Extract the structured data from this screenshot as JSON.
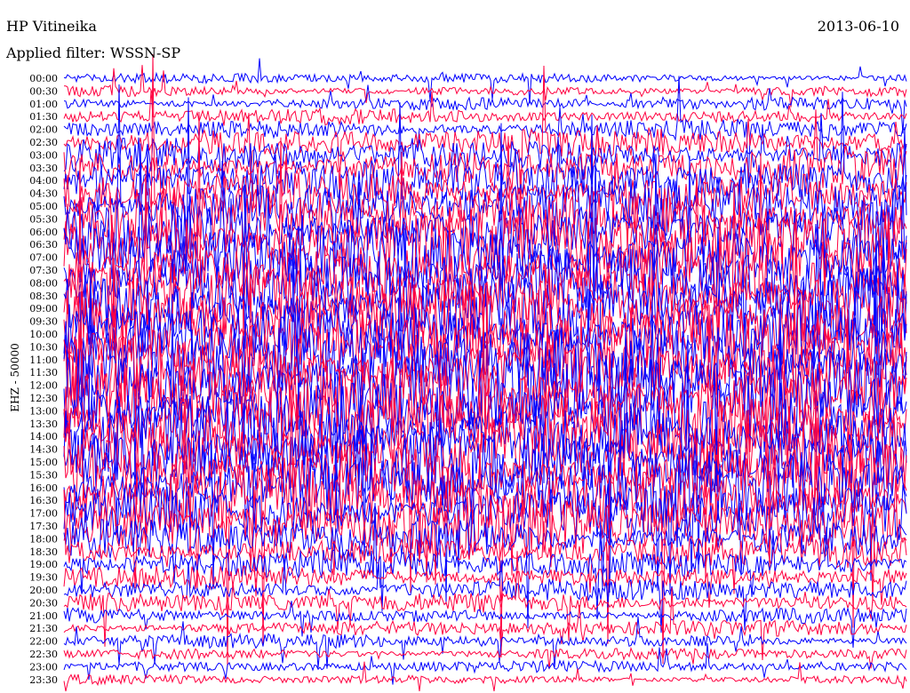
{
  "header": {
    "station": "HP Vitineika",
    "date": "2013-06-10",
    "filter": "Applied filter: WSSN-SP"
  },
  "chart_data": {
    "type": "line",
    "title": "HP Vitineika",
    "date": "2013-06-10",
    "filter": "WSSN-SP",
    "ylabel": "EHZ - 50000",
    "trace_labels": [
      "00:00",
      "00:30",
      "01:00",
      "01:30",
      "02:00",
      "02:30",
      "03:00",
      "03:30",
      "04:00",
      "04:30",
      "05:00",
      "05:30",
      "06:00",
      "06:30",
      "07:00",
      "07:30",
      "08:00",
      "08:30",
      "09:00",
      "09:30",
      "10:00",
      "10:30",
      "11:00",
      "11:30",
      "12:00",
      "12:30",
      "13:00",
      "13:30",
      "14:00",
      "14:30",
      "15:00",
      "15:30",
      "16:00",
      "16:30",
      "17:00",
      "17:30",
      "18:00",
      "18:30",
      "19:00",
      "19:30",
      "20:00",
      "20:30",
      "21:00",
      "21:30",
      "22:00",
      "22:30",
      "23:00",
      "23:30"
    ],
    "trace_colors": [
      "#0000ff",
      "#ff0040"
    ],
    "x_duration_minutes": 30,
    "trace_amplitude_envelope": [
      0.35,
      0.4,
      0.45,
      0.55,
      0.8,
      1.0,
      1.2,
      1.4,
      1.6,
      1.8,
      2.0,
      2.2,
      2.3,
      2.4,
      2.5,
      2.5,
      2.6,
      2.6,
      2.7,
      2.7,
      2.8,
      2.8,
      2.8,
      2.8,
      2.8,
      2.8,
      2.8,
      2.8,
      2.8,
      2.7,
      2.7,
      2.6,
      2.5,
      2.4,
      2.2,
      2.0,
      1.5,
      1.2,
      1.0,
      0.9,
      0.8,
      0.7,
      0.6,
      0.55,
      0.5,
      0.45,
      0.4,
      0.35
    ]
  }
}
